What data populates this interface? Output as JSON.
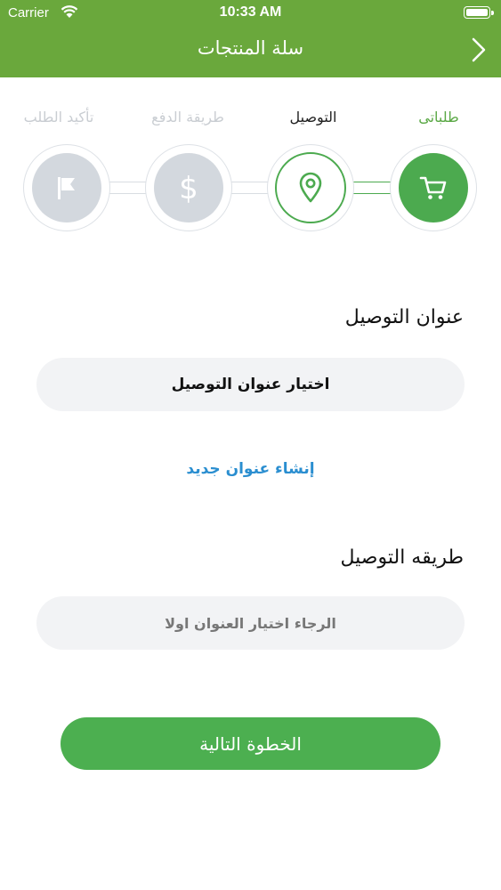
{
  "status_bar": {
    "carrier": "Carrier",
    "time": "10:33 AM"
  },
  "nav": {
    "title": "سلة المنتجات"
  },
  "steps": [
    {
      "label": "طلباتى",
      "icon": "cart-icon",
      "state": "done"
    },
    {
      "label": "التوصيل",
      "icon": "location-pin-icon",
      "state": "current"
    },
    {
      "label": "طريقة الدفع",
      "icon": "dollar-icon",
      "state": "pending"
    },
    {
      "label": "تأكيد الطلب",
      "icon": "flag-icon",
      "state": "pending"
    }
  ],
  "delivery_address": {
    "title": "عنوان التوصيل",
    "select_label": "اختيار عنوان التوصيل",
    "new_address_link": "إنشاء عنوان جديد"
  },
  "delivery_method": {
    "title": "طريقه التوصيل",
    "placeholder": "الرجاء اختيار العنوان اولا"
  },
  "next_button": {
    "label": "الخطوة التالية"
  },
  "colors": {
    "header": "#6aa83c",
    "accent": "#4caa4f",
    "link": "#2a8ed0",
    "inactive": "#d3d8de"
  }
}
